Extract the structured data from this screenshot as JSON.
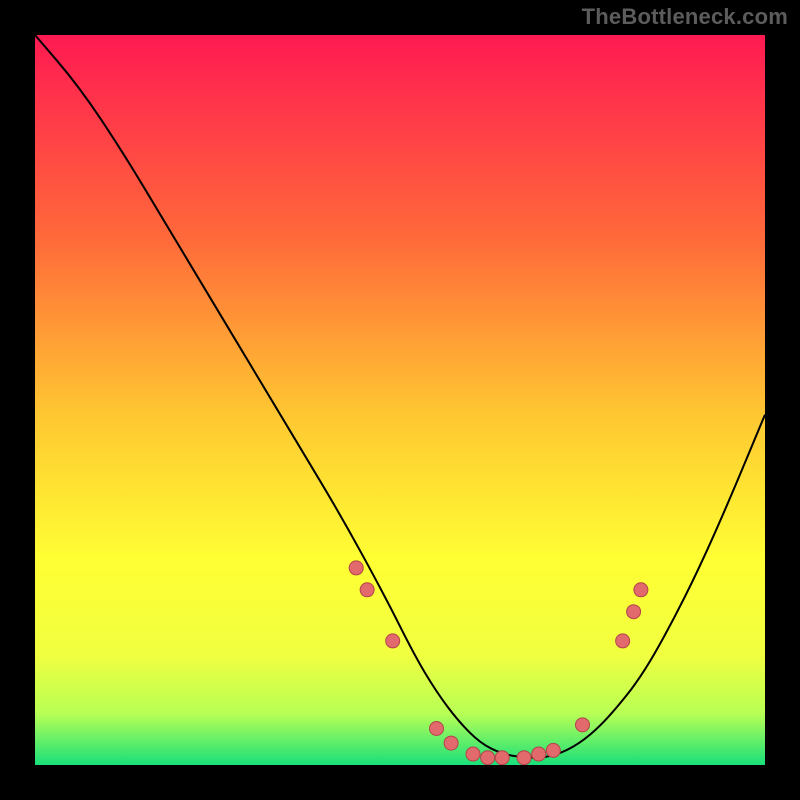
{
  "watermark": "TheBottleneck.com",
  "colors": {
    "black": "#000000",
    "curve": "#000000",
    "dot_fill": "#e26a6d",
    "dot_stroke": "#b24449",
    "grad_top": "#ff1a52",
    "grad_mid1": "#ff6a3a",
    "grad_mid2": "#ffc732",
    "grad_mid3": "#ffff33",
    "grad_mid4": "#f0ff40",
    "grad_mid5": "#b7ff55",
    "grad_bottom": "#18e07a"
  },
  "chart_data": {
    "type": "line",
    "title": "",
    "xlabel": "",
    "ylabel": "",
    "xlim": [
      0,
      100
    ],
    "ylim": [
      0,
      100
    ],
    "grid": false,
    "series": [
      {
        "name": "bottleneck-curve",
        "x": [
          0,
          6,
          12,
          18,
          24,
          30,
          36,
          42,
          48,
          52,
          55,
          58,
          61,
          64,
          67,
          70,
          73,
          76,
          79,
          83,
          87,
          91,
          95,
          100
        ],
        "y": [
          100,
          93,
          84,
          74,
          64,
          54,
          44,
          34,
          23,
          15,
          10,
          6,
          3,
          1.5,
          1,
          1,
          2,
          4,
          7,
          12,
          19,
          27,
          36,
          48
        ]
      }
    ],
    "markers": [
      {
        "x": 44.0,
        "y": 27.0
      },
      {
        "x": 45.5,
        "y": 24.0
      },
      {
        "x": 49.0,
        "y": 17.0
      },
      {
        "x": 55.0,
        "y": 5.0
      },
      {
        "x": 57.0,
        "y": 3.0
      },
      {
        "x": 60.0,
        "y": 1.5
      },
      {
        "x": 62.0,
        "y": 1.0
      },
      {
        "x": 64.0,
        "y": 1.0
      },
      {
        "x": 67.0,
        "y": 1.0
      },
      {
        "x": 69.0,
        "y": 1.5
      },
      {
        "x": 71.0,
        "y": 2.0
      },
      {
        "x": 75.0,
        "y": 5.5
      },
      {
        "x": 80.5,
        "y": 17.0
      },
      {
        "x": 82.0,
        "y": 21.0
      },
      {
        "x": 83.0,
        "y": 24.0
      }
    ]
  }
}
